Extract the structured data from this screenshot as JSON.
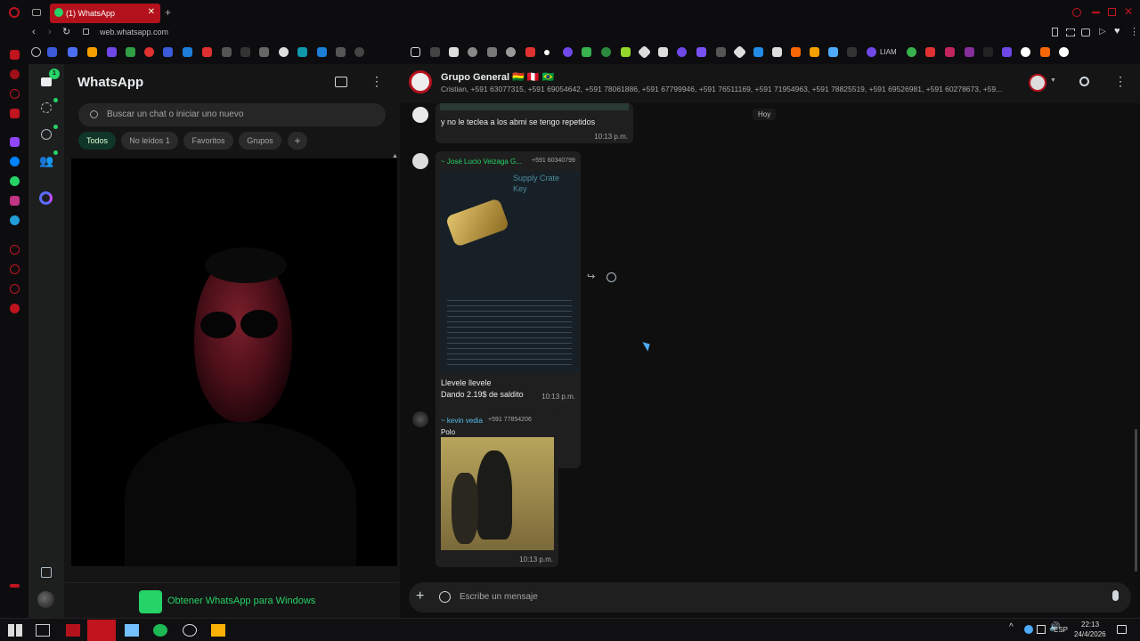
{
  "browser": {
    "tab_title": "(1) WhatsApp",
    "url": "web.whatsapp.com",
    "bookmark_label": "LIAM"
  },
  "rail": {
    "chats_badge": "1"
  },
  "sidebar": {
    "title": "WhatsApp",
    "search_placeholder": "Buscar un chat o iniciar uno nuevo",
    "filters": [
      {
        "label": "Todos"
      },
      {
        "label": "No leídos 1"
      },
      {
        "label": "Favoritos"
      },
      {
        "label": "Grupos"
      }
    ],
    "promo_label": "Obtener WhatsApp para Windows"
  },
  "chat": {
    "name": "Grupo General 🇧🇴 🇵🇪 🇧🇷",
    "members": "Cristian, +591 63077315, +591 69054642, +591 78061886, +591 67799946, +591 76511169, +591 71954963, +591 78825519, +591 69526981, +591 60278673, +59...",
    "date_divider": "Hoy",
    "messages": [
      {
        "text": "y no le teclea a los abmi se tengo repetidos",
        "time": "10:13 p.m."
      },
      {
        "sender": "~ José Lucio Veizaga G...",
        "phone": "+591 60340799",
        "image_title": "Supply Crate Key",
        "caption_1": "Llevele llevele",
        "caption_2": "Dando 2.19$ de saldito",
        "time": "10:13 p.m."
      },
      {
        "sender": "~ kevin vedia",
        "phone": "+591 77854206",
        "text": "Polo",
        "time": "10:13 p.m."
      }
    ]
  },
  "composer": {
    "placeholder": "Escribe un mensaje"
  },
  "taskbar": {
    "lang": "ESP",
    "time": "22:13",
    "date": "24/4/2026"
  },
  "colors": {
    "accent": "#25d366",
    "opera_red": "#b3121d",
    "sender1": "#53bdeb",
    "sender2": "#7fd1a3"
  }
}
